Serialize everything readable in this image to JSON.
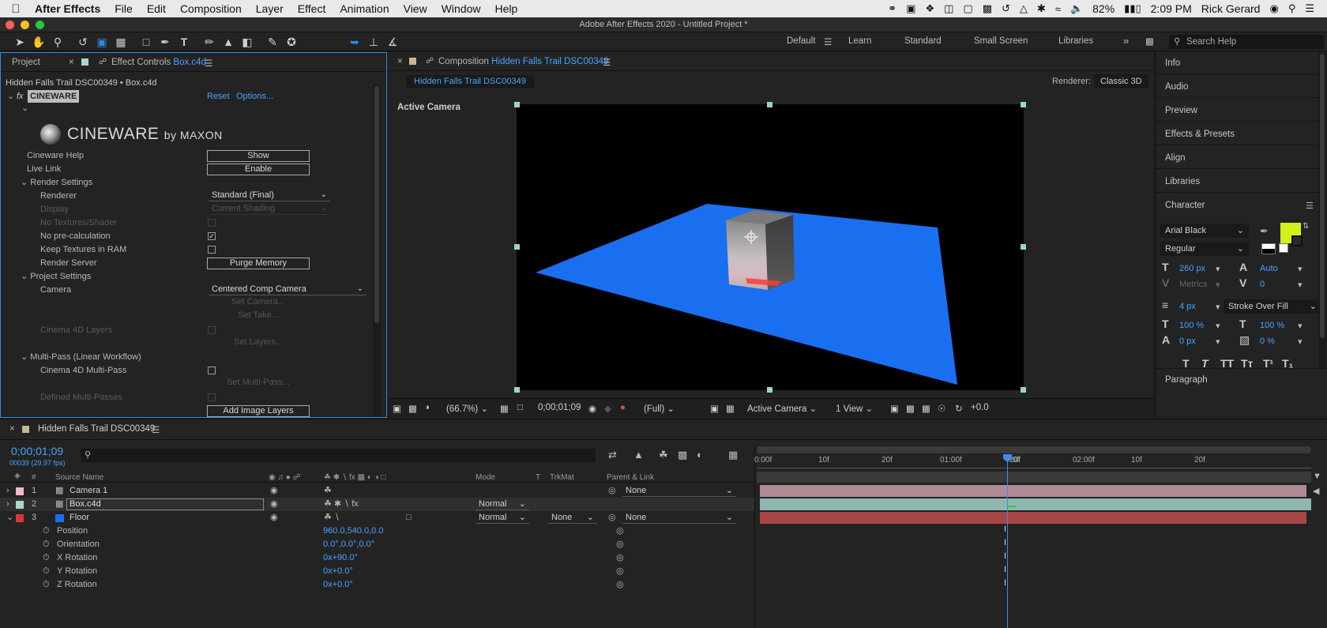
{
  "menubar": {
    "app": "After Effects",
    "items": [
      "File",
      "Edit",
      "Composition",
      "Layer",
      "Effect",
      "Animation",
      "View",
      "Window",
      "Help"
    ],
    "battery": "82%",
    "clock": "2:09 PM",
    "user": "Rick Gerard"
  },
  "window": {
    "title": "Adobe After Effects 2020 - Untitled Project *"
  },
  "workspaces": [
    "Default",
    "Learn",
    "Standard",
    "Small Screen",
    "Libraries"
  ],
  "search_help": {
    "placeholder": "Search Help"
  },
  "effect_controls": {
    "tab_project": "Project",
    "tab_label": "Effect Controls",
    "tab_file": "Box.c4d",
    "breadcrumb": "Hidden Falls Trail DSC00349 • Box.c4d",
    "fx_badge": "fx",
    "effect_name": "CINEWARE",
    "reset": "Reset",
    "options": "Options...",
    "logo_main": "CINEWARE",
    "logo_by": "by MAXON",
    "rows": {
      "help_label": "Cineware Help",
      "help_btn": "Show",
      "live_label": "Live Link",
      "live_btn": "Enable",
      "render_settings": "Render Settings",
      "renderer_label": "Renderer",
      "renderer_value": "Standard (Final)",
      "display_label": "Display",
      "display_value": "Current Shading",
      "no_textures": "No Textures/Shader",
      "no_precalc": "No pre-calculation",
      "keep_textures": "Keep Textures in RAM",
      "render_server": "Render Server",
      "purge_btn": "Purge Memory",
      "project_settings": "Project Settings",
      "camera_label": "Camera",
      "camera_value": "Centered Comp Camera",
      "set_camera": "Set Camera...",
      "set_take": "Set Take...",
      "c4d_layers": "Cinema 4D Layers",
      "set_layers": "Set Layers...",
      "multipass": "Multi-Pass (Linear Workflow)",
      "c4d_multipass": "Cinema 4D Multi-Pass",
      "set_multipass": "Set Multi-Pass...",
      "defined_multipasses": "Defined Multi-Passes",
      "add_image_layers": "Add Image Layers"
    }
  },
  "composition": {
    "tab_label": "Composition",
    "tab_name": "Hidden Falls Trail DSC00349",
    "subtab": "Hidden Falls Trail DSC00349",
    "renderer_label": "Renderer:",
    "renderer_value": "Classic 3D",
    "view_label": "Active Camera",
    "zoom": "(66.7%)",
    "timecode": "0;00;01;09",
    "resolution": "(Full)",
    "camera": "Active Camera",
    "views": "1 View",
    "exposure": "+0.0",
    "colors": {
      "floor": "#1a6ff0",
      "bg": "#000000"
    }
  },
  "right_panels": {
    "items": [
      "Info",
      "Audio",
      "Preview",
      "Effects & Presets",
      "Align",
      "Libraries"
    ],
    "character": {
      "title": "Character",
      "font": "Arial Black",
      "style": "Regular",
      "size": "260 px",
      "leading": "Auto",
      "kerning": "Metrics",
      "tracking": "0",
      "stroke_width": "4 px",
      "stroke_mode": "Stroke Over Fill",
      "vscale": "100 %",
      "hscale": "100 %",
      "baseline": "0 px",
      "tsume": "0 %",
      "fill_color": "#d4f01c"
    },
    "paragraph": "Paragraph"
  },
  "timeline": {
    "tab_name": "Hidden Falls Trail DSC00349",
    "timecode": "0;00;01;09",
    "frames": "00039 (29.97 fps)",
    "col_source": "Source Name",
    "col_mode": "Mode",
    "col_t": "T",
    "col_trkmat": "TrkMat",
    "col_parent": "Parent & Link",
    "ruler": [
      "0:00f",
      "10f",
      "20f",
      "01:00f",
      "10f",
      "20f",
      "02:00f",
      "10f",
      "20f"
    ],
    "ruler_cursor_label": "0f",
    "layers": [
      {
        "num": "1",
        "name": "Camera 1",
        "color": "#f0b8c8",
        "parent": "None",
        "mode": "",
        "trkmat": ""
      },
      {
        "num": "2",
        "name": "Box.c4d",
        "color": "#a8d8d0",
        "parent": "",
        "mode": "Normal",
        "trkmat": ""
      },
      {
        "num": "3",
        "name": "Floor",
        "color": "#d83838",
        "parent": "None",
        "mode": "Normal",
        "trkmat": "None"
      }
    ],
    "properties": [
      {
        "name": "Position",
        "value": "960.0,540.0,0.0"
      },
      {
        "name": "Orientation",
        "value": "0.0°,0.0°,0.0°"
      },
      {
        "name": "X Rotation",
        "value": "0x+90.0°"
      },
      {
        "name": "Y Rotation",
        "value": "0x+0.0°"
      },
      {
        "name": "Z Rotation",
        "value": "0x+0.0°"
      }
    ]
  }
}
